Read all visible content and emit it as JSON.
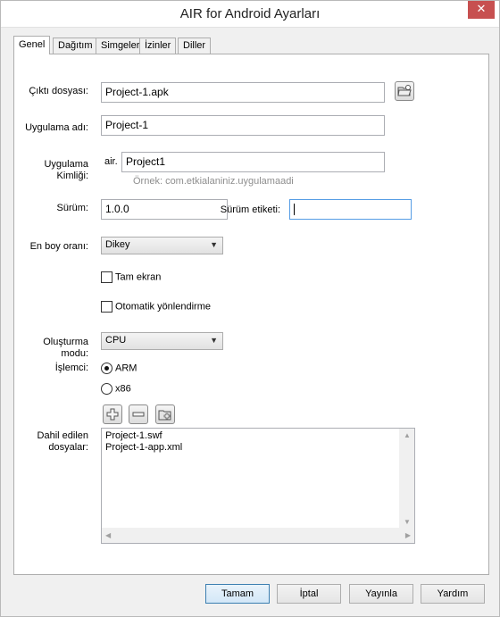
{
  "window": {
    "title": "AIR for Android Ayarları",
    "close_glyph": "✕"
  },
  "tabs": [
    "Genel",
    "Dağıtım",
    "Simgeler",
    "İzinler",
    "Diller"
  ],
  "form": {
    "output_label": "Çıktı dosyası:",
    "output_value": "Project-1.apk",
    "app_name_label": "Uygulama adı:",
    "app_name_value": "Project-1",
    "app_id_label": "Uygulama Kimliği:",
    "app_id_prefix": "air.",
    "app_id_value": "Project1",
    "app_id_hint": "Örnek: com.etkialaniniz.uygulamaadi",
    "version_label": "Sürüm:",
    "version_value": "1.0.0",
    "version_tag_label": "Sürüm etiketi:",
    "version_tag_value": "",
    "aspect_label": "En boy oranı:",
    "aspect_value": "Dikey",
    "fullscreen_label": "Tam ekran",
    "fullscreen_checked": false,
    "auto_orient_label": "Otomatik yönlendirme",
    "auto_orient_checked": false,
    "render_mode_label": "Oluşturma modu:",
    "render_mode_value": "CPU",
    "processor_label": "İşlemci:",
    "processor_options": [
      "ARM",
      "x86"
    ],
    "processor_selected": "ARM",
    "included_files_label": "Dahil edilen dosyalar:",
    "included_files": [
      "Project-1.swf",
      "Project-1-app.xml"
    ]
  },
  "icons": {
    "browse": "folder-open-icon",
    "add": "plus-icon",
    "remove": "minus-icon",
    "add_folder": "add-folder-icon"
  },
  "buttons": {
    "ok": "Tamam",
    "cancel": "İptal",
    "publish": "Yayınla",
    "help": "Yardım"
  },
  "colors": {
    "close": "#c75050",
    "focus": "#569de5",
    "default_button": "#3c7fb1"
  }
}
